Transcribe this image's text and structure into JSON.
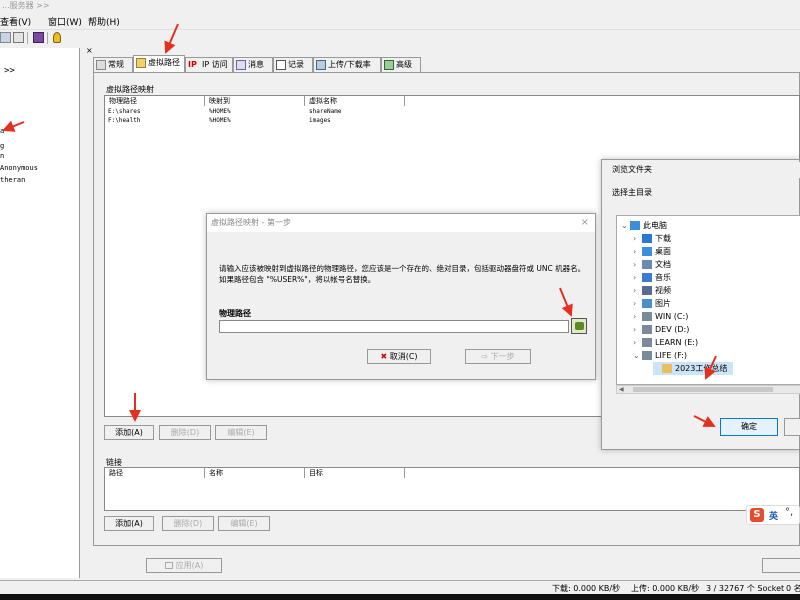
{
  "window": {
    "title": "...服务器 >>"
  },
  "menu": [
    "查看(V)",
    "窗口(W)",
    "帮助(H)"
  ],
  "left_panel": {
    "chevron": ">>",
    "lines": [
      "a",
      "g",
      "n",
      "Anonymous",
      "theran"
    ]
  },
  "tabs": [
    {
      "label": "常规"
    },
    {
      "label": "虚拟路径"
    },
    {
      "label": "IP 访问"
    },
    {
      "label": "消息"
    },
    {
      "label": "记录"
    },
    {
      "label": "上传/下载率"
    },
    {
      "label": "高级"
    }
  ],
  "virtual_paths": {
    "group_label": "虚拟路径映射",
    "columns": [
      "物理路径",
      "映射到",
      "虚拟名称"
    ],
    "rows": [
      {
        "physical": "E:\\shares",
        "mapped": "%HOME%",
        "virtual": "shareName"
      },
      {
        "physical": "F:\\health",
        "mapped": "%HOME%",
        "virtual": "images"
      }
    ],
    "buttons": {
      "add": "添加(A)",
      "delete": "删除(D)",
      "edit": "编辑(E)"
    }
  },
  "links": {
    "group_label": "链接",
    "columns": [
      "路径",
      "名称",
      "目标"
    ],
    "buttons": {
      "add": "添加(A)",
      "delete": "删除(D)",
      "edit": "编辑(E)"
    }
  },
  "apply_label": "应用(A)",
  "status": {
    "download": "下载: 0.000 KB/秒",
    "upload": "上传: 0.000 KB/秒",
    "sockets": "3 / 32767 个 Socket",
    "tail": "0 名"
  },
  "wizard_dialog": {
    "title": "虚拟路径映射 - 第一步",
    "instructions": "请输入应该被映射到虚拟路径的物理路径，您应该是一个存在的、绝对目录，包括驱动器盘符或 UNC 机器名。如果路径包含 \"%USER%\"，将以帐号名替换。",
    "field_label": "物理路径",
    "field_value": "",
    "cancel": "取消(C)",
    "next": "下一步"
  },
  "browse_dialog": {
    "title": "浏览文件夹",
    "subtitle": "选择主目录",
    "tree": [
      {
        "label": "此电脑",
        "icon": "computer-icon",
        "color": "#3a8fd8"
      },
      {
        "label": "下载",
        "icon": "download-icon",
        "color": "#2a7ad0"
      },
      {
        "label": "桌面",
        "icon": "desktop-icon",
        "color": "#3b8fe0"
      },
      {
        "label": "文档",
        "icon": "document-icon",
        "color": "#6a8ab0"
      },
      {
        "label": "音乐",
        "icon": "music-icon",
        "color": "#3a7ad0"
      },
      {
        "label": "视频",
        "icon": "video-icon",
        "color": "#5a6a90"
      },
      {
        "label": "图片",
        "icon": "picture-icon",
        "color": "#4a90c8"
      },
      {
        "label": "WIN (C:)",
        "icon": "drive-icon",
        "color": "#7a8a9a"
      },
      {
        "label": "DEV (D:)",
        "icon": "drive-icon",
        "color": "#7a8a9a"
      },
      {
        "label": "LEARN (E:)",
        "icon": "drive-icon",
        "color": "#7a8a9a"
      },
      {
        "label": "LIFE (F:)",
        "icon": "drive-icon",
        "color": "#7a8a9a"
      },
      {
        "label": "2023工作总结",
        "icon": "folder-icon",
        "color": "#e8c060"
      }
    ],
    "ok": "确定"
  },
  "ime": {
    "label": "英"
  },
  "colors": {
    "annotation": "#e53020",
    "selection": "#cce4f7",
    "ime_red": "#e84a2a"
  }
}
